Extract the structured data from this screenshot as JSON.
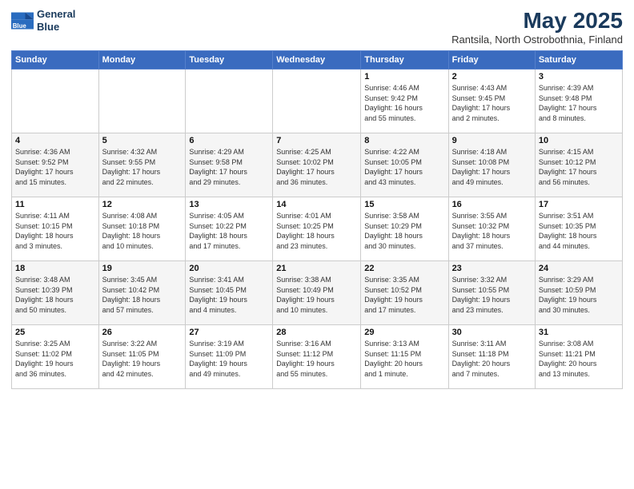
{
  "logo": {
    "line1": "General",
    "line2": "Blue"
  },
  "title": "May 2025",
  "subtitle": "Rantsila, North Ostrobothnia, Finland",
  "header": {
    "days": [
      "Sunday",
      "Monday",
      "Tuesday",
      "Wednesday",
      "Thursday",
      "Friday",
      "Saturday"
    ]
  },
  "weeks": [
    [
      {
        "day": "",
        "detail": ""
      },
      {
        "day": "",
        "detail": ""
      },
      {
        "day": "",
        "detail": ""
      },
      {
        "day": "",
        "detail": ""
      },
      {
        "day": "1",
        "detail": "Sunrise: 4:46 AM\nSunset: 9:42 PM\nDaylight: 16 hours\nand 55 minutes."
      },
      {
        "day": "2",
        "detail": "Sunrise: 4:43 AM\nSunset: 9:45 PM\nDaylight: 17 hours\nand 2 minutes."
      },
      {
        "day": "3",
        "detail": "Sunrise: 4:39 AM\nSunset: 9:48 PM\nDaylight: 17 hours\nand 8 minutes."
      }
    ],
    [
      {
        "day": "4",
        "detail": "Sunrise: 4:36 AM\nSunset: 9:52 PM\nDaylight: 17 hours\nand 15 minutes."
      },
      {
        "day": "5",
        "detail": "Sunrise: 4:32 AM\nSunset: 9:55 PM\nDaylight: 17 hours\nand 22 minutes."
      },
      {
        "day": "6",
        "detail": "Sunrise: 4:29 AM\nSunset: 9:58 PM\nDaylight: 17 hours\nand 29 minutes."
      },
      {
        "day": "7",
        "detail": "Sunrise: 4:25 AM\nSunset: 10:02 PM\nDaylight: 17 hours\nand 36 minutes."
      },
      {
        "day": "8",
        "detail": "Sunrise: 4:22 AM\nSunset: 10:05 PM\nDaylight: 17 hours\nand 43 minutes."
      },
      {
        "day": "9",
        "detail": "Sunrise: 4:18 AM\nSunset: 10:08 PM\nDaylight: 17 hours\nand 49 minutes."
      },
      {
        "day": "10",
        "detail": "Sunrise: 4:15 AM\nSunset: 10:12 PM\nDaylight: 17 hours\nand 56 minutes."
      }
    ],
    [
      {
        "day": "11",
        "detail": "Sunrise: 4:11 AM\nSunset: 10:15 PM\nDaylight: 18 hours\nand 3 minutes."
      },
      {
        "day": "12",
        "detail": "Sunrise: 4:08 AM\nSunset: 10:18 PM\nDaylight: 18 hours\nand 10 minutes."
      },
      {
        "day": "13",
        "detail": "Sunrise: 4:05 AM\nSunset: 10:22 PM\nDaylight: 18 hours\nand 17 minutes."
      },
      {
        "day": "14",
        "detail": "Sunrise: 4:01 AM\nSunset: 10:25 PM\nDaylight: 18 hours\nand 23 minutes."
      },
      {
        "day": "15",
        "detail": "Sunrise: 3:58 AM\nSunset: 10:29 PM\nDaylight: 18 hours\nand 30 minutes."
      },
      {
        "day": "16",
        "detail": "Sunrise: 3:55 AM\nSunset: 10:32 PM\nDaylight: 18 hours\nand 37 minutes."
      },
      {
        "day": "17",
        "detail": "Sunrise: 3:51 AM\nSunset: 10:35 PM\nDaylight: 18 hours\nand 44 minutes."
      }
    ],
    [
      {
        "day": "18",
        "detail": "Sunrise: 3:48 AM\nSunset: 10:39 PM\nDaylight: 18 hours\nand 50 minutes."
      },
      {
        "day": "19",
        "detail": "Sunrise: 3:45 AM\nSunset: 10:42 PM\nDaylight: 18 hours\nand 57 minutes."
      },
      {
        "day": "20",
        "detail": "Sunrise: 3:41 AM\nSunset: 10:45 PM\nDaylight: 19 hours\nand 4 minutes."
      },
      {
        "day": "21",
        "detail": "Sunrise: 3:38 AM\nSunset: 10:49 PM\nDaylight: 19 hours\nand 10 minutes."
      },
      {
        "day": "22",
        "detail": "Sunrise: 3:35 AM\nSunset: 10:52 PM\nDaylight: 19 hours\nand 17 minutes."
      },
      {
        "day": "23",
        "detail": "Sunrise: 3:32 AM\nSunset: 10:55 PM\nDaylight: 19 hours\nand 23 minutes."
      },
      {
        "day": "24",
        "detail": "Sunrise: 3:29 AM\nSunset: 10:59 PM\nDaylight: 19 hours\nand 30 minutes."
      }
    ],
    [
      {
        "day": "25",
        "detail": "Sunrise: 3:25 AM\nSunset: 11:02 PM\nDaylight: 19 hours\nand 36 minutes."
      },
      {
        "day": "26",
        "detail": "Sunrise: 3:22 AM\nSunset: 11:05 PM\nDaylight: 19 hours\nand 42 minutes."
      },
      {
        "day": "27",
        "detail": "Sunrise: 3:19 AM\nSunset: 11:09 PM\nDaylight: 19 hours\nand 49 minutes."
      },
      {
        "day": "28",
        "detail": "Sunrise: 3:16 AM\nSunset: 11:12 PM\nDaylight: 19 hours\nand 55 minutes."
      },
      {
        "day": "29",
        "detail": "Sunrise: 3:13 AM\nSunset: 11:15 PM\nDaylight: 20 hours\nand 1 minute."
      },
      {
        "day": "30",
        "detail": "Sunrise: 3:11 AM\nSunset: 11:18 PM\nDaylight: 20 hours\nand 7 minutes."
      },
      {
        "day": "31",
        "detail": "Sunrise: 3:08 AM\nSunset: 11:21 PM\nDaylight: 20 hours\nand 13 minutes."
      }
    ]
  ]
}
